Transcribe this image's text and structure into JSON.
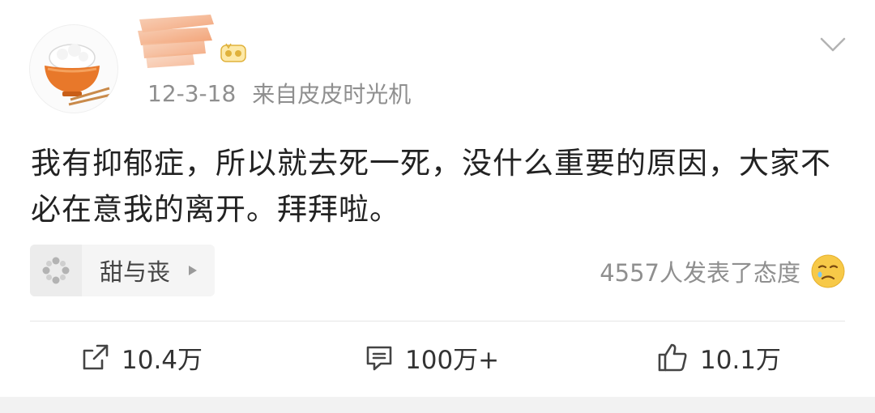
{
  "post": {
    "date": "12-3-18",
    "source": "来自皮皮时光机",
    "text": "我有抑郁症，所以就去死一死，没什么重要的原因，大家不必在意我的离开。拜拜啦。"
  },
  "topic": {
    "label": "甜与丧",
    "icon": "pinwheel-icon"
  },
  "reactions": {
    "summary": "4557人发表了态度",
    "emoji_icon": "sad-face-icon"
  },
  "actions": {
    "repost_count": "10.4万",
    "comment_count": "100万+",
    "like_count": "10.1万"
  },
  "colors": {
    "accent_orange": "#e8782a",
    "muted_text": "#8f8f8f",
    "emoji_yellow": "#f7c948"
  }
}
